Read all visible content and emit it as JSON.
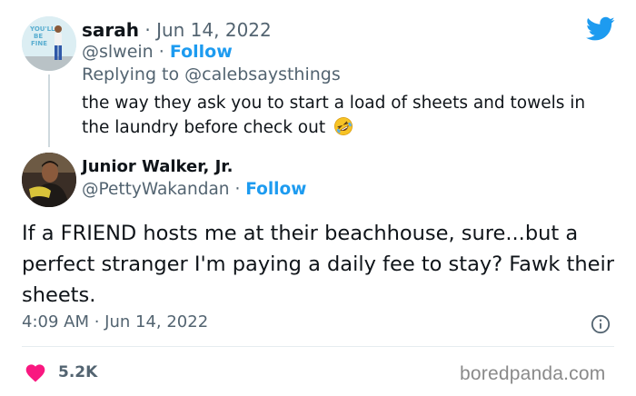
{
  "parent_tweet": {
    "display_name": "sarah",
    "date": "Jun 14, 2022",
    "handle": "@slwein",
    "follow_label": "Follow",
    "replying_prefix": "Replying to",
    "replying_handle": "@calebsaysthings",
    "text": "the way they ask you to start a load of sheets and towels in the laundry before check out",
    "emoji": "rolling-on-floor-laughing",
    "avatar_wall_text": "YOU'LL BE FINE"
  },
  "reply_tweet": {
    "display_name": "Junior Walker, Jr.",
    "handle": "@PettyWakandan",
    "follow_label": "Follow",
    "text": "If a FRIEND hosts me at their beachhouse, sure...but a perfect stranger I'm paying a daily fee to stay? Fawk their sheets.",
    "timestamp": "4:09 AM · Jun 14, 2022",
    "like_count": "5.2K"
  },
  "watermark": "boredpanda.com",
  "colors": {
    "twitter_blue": "#1d9bf0",
    "like_red": "#f91880",
    "text_primary": "#0f1419",
    "text_muted": "#536471"
  },
  "icons": {
    "brand": "twitter-bird-icon",
    "info": "info-icon",
    "like": "heart-icon"
  },
  "separator": "·"
}
